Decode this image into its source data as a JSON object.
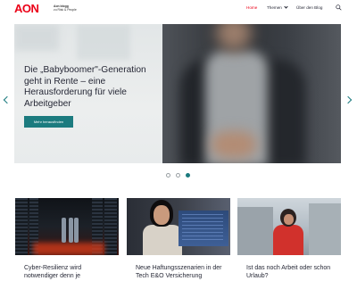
{
  "header": {
    "logo": "AON",
    "tagline_line1": "Aon blogg",
    "tagline_line2": "zu Risk & People",
    "nav": [
      {
        "label": "Home",
        "active": true
      },
      {
        "label": "Themen",
        "has_dropdown": true
      },
      {
        "label": "Über den Blog"
      }
    ],
    "search_icon": "search-icon"
  },
  "hero": {
    "title": "Die „Babyboomer\"-Generation geht in Rente – eine Herausforderung für viele Arbeitgeber",
    "cta_label": "Mehr herausfinden",
    "slides_total": 3,
    "active_slide": 3
  },
  "cards": [
    {
      "title": "Cyber-Resilienz wird notwendiger denn je"
    },
    {
      "title": "Neue Haftungsszenarien in der Tech E&O Versicherung"
    },
    {
      "title": "Ist das noch Arbeit oder schon Urlaub?"
    }
  ],
  "colors": {
    "brand_red": "#eb0017",
    "accent_teal": "#1c7b7f",
    "text": "#262836"
  }
}
